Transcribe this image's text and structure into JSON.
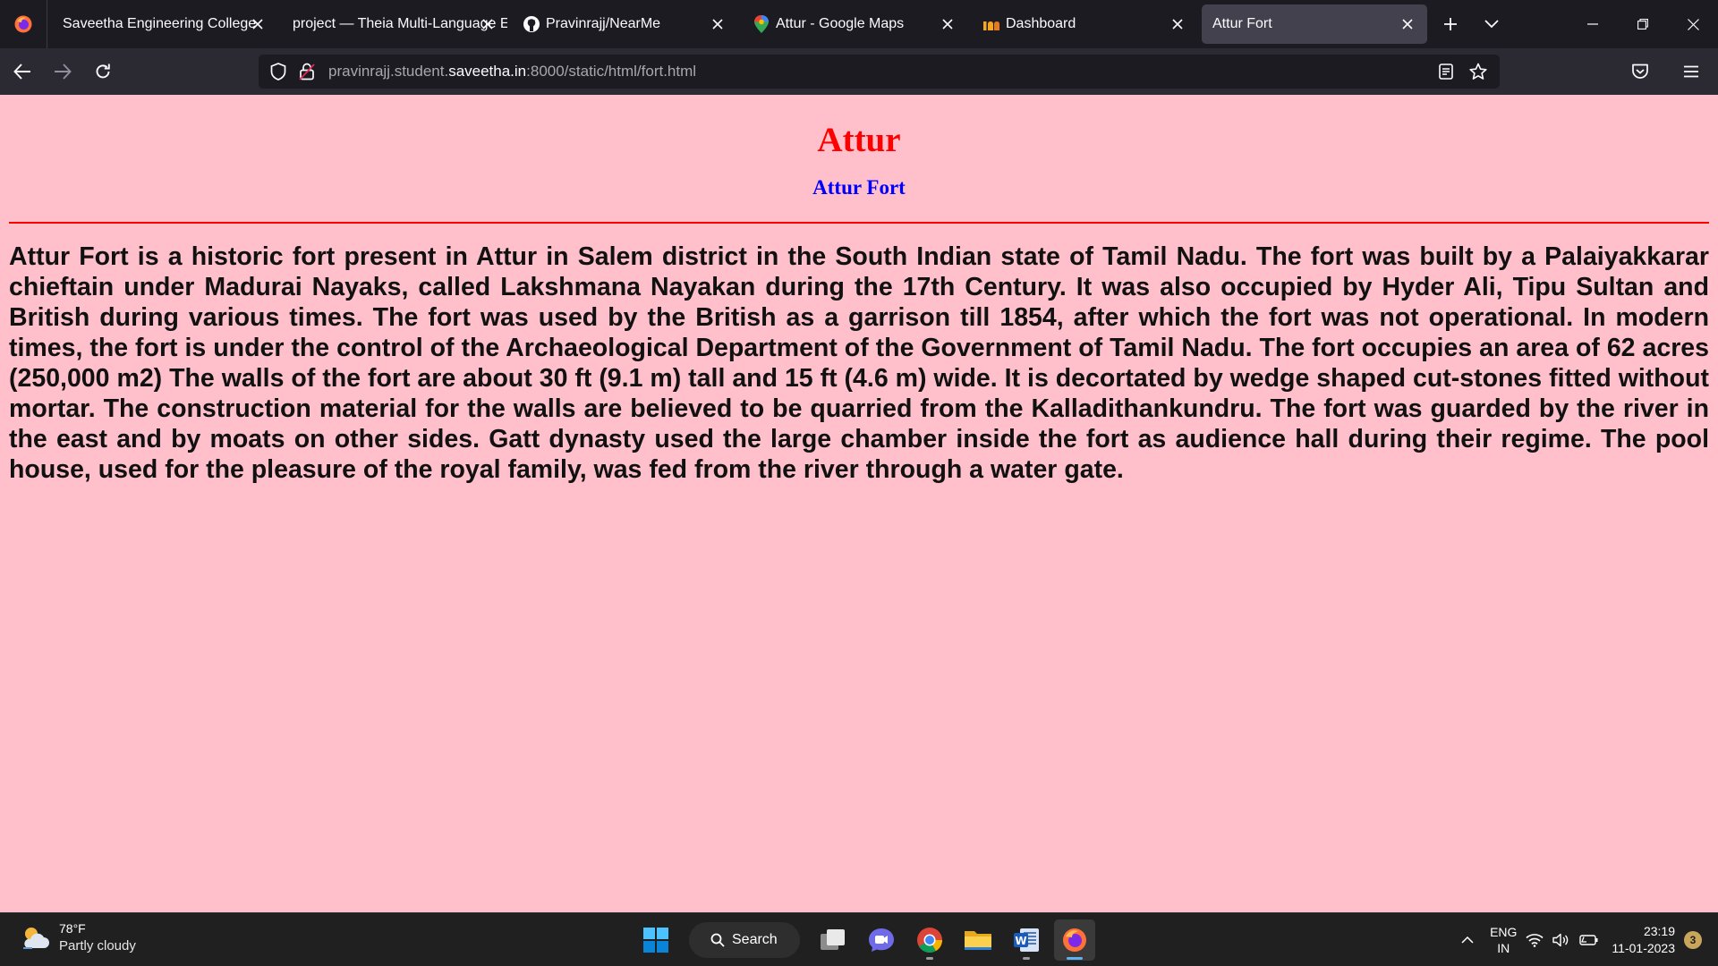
{
  "browser": {
    "tabs": [
      {
        "title": "Saveetha Engineering College",
        "icon": "firefox-icon"
      },
      {
        "title": "project — Theia Multi-Language Example",
        "icon": "none"
      },
      {
        "title": "Pravinrajj/NearMe",
        "icon": "github-icon"
      },
      {
        "title": "Attur - Google Maps",
        "icon": "maps-pin-icon"
      },
      {
        "title": "Dashboard",
        "icon": "dashboard-icon"
      },
      {
        "title": "Attur Fort",
        "icon": "none",
        "active": true
      }
    ],
    "url": {
      "prefix": "pravinrajj.student.",
      "host": "saveetha.in",
      "suffix": ":8000/static/html/fort.html"
    }
  },
  "page": {
    "heading": "Attur",
    "subheading": "Attur Fort",
    "paragraph": "Attur Fort is a historic fort present in Attur in Salem district in the South Indian state of Tamil Nadu. The fort was built by a Palaiyakkarar chieftain under Madurai Nayaks, called Lakshmana Nayakan during the 17th Century. It was also occupied by Hyder Ali, Tipu Sultan and British during various times. The fort was used by the British as a garrison till 1854, after which the fort was not operational. In modern times, the fort is under the control of the Archaeological Department of the Government of Tamil Nadu. The fort occupies an area of 62 acres (250,000 m2) The walls of the fort are about 30 ft (9.1 m) tall and 15 ft (4.6 m) wide. It is decortated by wedge shaped cut-stones fitted without mortar. The construction material for the walls are believed to be quarried from the Kalladithankundru. The fort was guarded by the river in the east and by moats on other sides. Gatt dynasty used the large chamber inside the fort as audience hall during their regime. The pool house, used for the pleasure of the royal family, was fed from the river through a water gate.",
    "colors": {
      "background": "#ffc0cb",
      "heading": "#ff0000",
      "subheading": "#0000ff",
      "divider": "#ff0000"
    }
  },
  "taskbar": {
    "weather": {
      "temp": "78°F",
      "desc": "Partly cloudy"
    },
    "search_label": "Search",
    "apps": [
      "task-view-icon",
      "teams-chat-icon",
      "chrome-icon",
      "file-explorer-icon",
      "word-icon",
      "firefox-icon"
    ],
    "lang": {
      "line1": "ENG",
      "line2": "IN"
    },
    "clock": {
      "time": "23:19",
      "date": "11-01-2023"
    },
    "notification_count": "3"
  }
}
